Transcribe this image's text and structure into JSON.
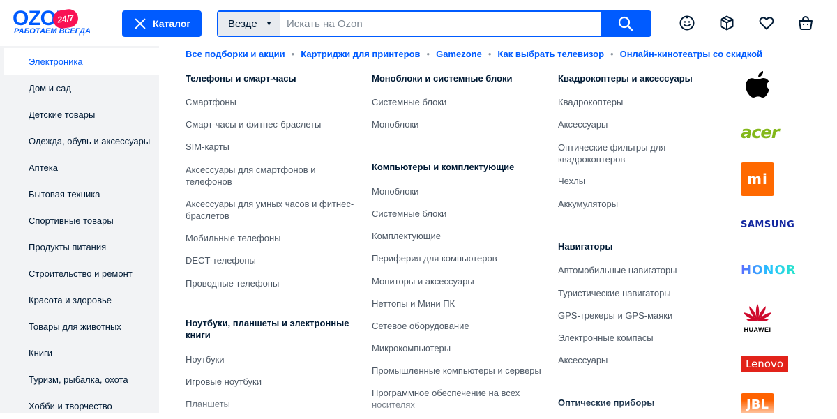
{
  "header": {
    "logo_main": "OZON",
    "logo_badge": "24/7",
    "logo_sub": "РАБОТАЕМ ВСЕГДА",
    "catalog_label": "Каталог",
    "search_scope": "Везде",
    "search_placeholder": "Искать на Ozon",
    "accent": "#005bff",
    "badge_color": "#f91155",
    "icons": [
      "profile-icon",
      "orders-box-icon",
      "favorites-heart-icon",
      "cart-icon"
    ]
  },
  "sidebar": {
    "items": [
      {
        "label": "Электроника",
        "active": true
      },
      {
        "label": "Дом и сад"
      },
      {
        "label": "Детские товары"
      },
      {
        "label": "Одежда, обувь и аксессуары"
      },
      {
        "label": "Аптека"
      },
      {
        "label": "Бытовая техника"
      },
      {
        "label": "Спортивные товары"
      },
      {
        "label": "Продукты питания"
      },
      {
        "label": "Строительство и ремонт"
      },
      {
        "label": "Красота и здоровье"
      },
      {
        "label": "Товары для животных"
      },
      {
        "label": "Книги"
      },
      {
        "label": "Туризм, рыбалка, охота"
      },
      {
        "label": "Хобби и творчество"
      }
    ]
  },
  "quick_links": [
    "Все подборки и акции",
    "Картриджи для принтеров",
    "Gamezone",
    "Как выбрать телевизор",
    "Онлайн-кинотеатры со скидкой"
  ],
  "columns": [
    {
      "groups": [
        {
          "title": "Телефоны и смарт-часы",
          "links": [
            "Смартфоны",
            "Смарт-часы и фитнес-браслеты",
            "SIM-карты",
            "Аксессуары для смартфонов и телефонов",
            "Аксессуары для умных часов и фитнес-браслетов",
            "Мобильные телефоны",
            "DECT-телефоны",
            "Проводные телефоны"
          ]
        },
        {
          "title": "Ноутбуки, планшеты и электронные книги",
          "links": [
            "Ноутбуки",
            "Игровые ноутбуки",
            "Планшеты"
          ]
        }
      ]
    },
    {
      "groups": [
        {
          "title": "Моноблоки и системные блоки",
          "links": [
            "Системные блоки",
            "Моноблоки"
          ]
        },
        {
          "title": "Компьютеры и комплектующие",
          "links": [
            "Моноблоки",
            "Системные блоки",
            "Комплектующие",
            "Периферия для компьютеров",
            "Мониторы и аксессуары",
            "Неттопы и Мини ПК",
            "Сетевое оборудование",
            "Микрокомпьютеры",
            "Промышленные компьютеры и серверы",
            "Программное обеспечение на всех носителях"
          ]
        }
      ]
    },
    {
      "groups": [
        {
          "title": "Квадрокоптеры и аксессуары",
          "links": [
            "Квадрокоптеры",
            "Аксессуары",
            "Оптические фильтры для квадрокоптеров",
            "Чехлы",
            "Аккумуляторы"
          ]
        },
        {
          "title": "Навигаторы",
          "links": [
            "Автомобильные навигаторы",
            "Туристические навигаторы",
            "GPS-трекеры и GPS-маяки",
            "Электронные компасы",
            "Аксессуары"
          ]
        },
        {
          "title": "Оптические приборы",
          "links": []
        }
      ]
    }
  ],
  "brands": [
    {
      "name": "apple-logo"
    },
    {
      "name": "acer-logo",
      "text": "acer",
      "color": "#83b81a"
    },
    {
      "name": "xiaomi-logo",
      "text": "mi",
      "color": "#ff6900"
    },
    {
      "name": "samsung-logo",
      "text": "SAMSUNG",
      "color": "#1428a0"
    },
    {
      "name": "honor-logo",
      "text": "HONOR"
    },
    {
      "name": "huawei-logo",
      "text": "HUAWEI",
      "color": "#cf0a2c"
    },
    {
      "name": "lenovo-logo",
      "text": "Lenovo",
      "color": "#e2231a"
    },
    {
      "name": "jbl-logo",
      "text": "JBL",
      "color": "#ff6200"
    }
  ]
}
